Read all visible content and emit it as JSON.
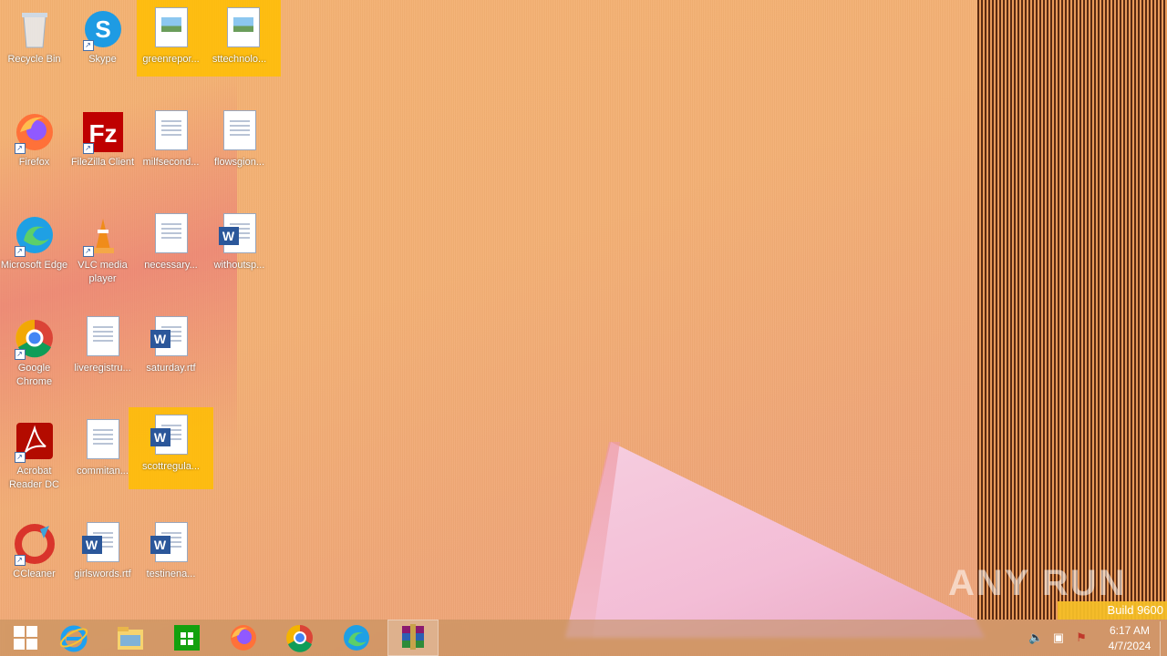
{
  "desktop": {
    "icons": [
      {
        "label": "Recycle Bin",
        "icon": "recycle-bin-icon",
        "type": "app"
      },
      {
        "label": "Skype",
        "icon": "skype-icon",
        "type": "app"
      },
      {
        "label": "greenrepor...",
        "icon": "image-file-icon",
        "type": "img"
      },
      {
        "label": "sttechnolo...",
        "icon": "image-file-icon",
        "type": "img"
      },
      {
        "label": "Firefox",
        "icon": "firefox-icon",
        "type": "app"
      },
      {
        "label": "FileZilla Client",
        "icon": "filezilla-icon",
        "type": "app"
      },
      {
        "label": "milfsecond...",
        "icon": "document-icon",
        "type": "doc"
      },
      {
        "label": "flowsgion...",
        "icon": "document-icon",
        "type": "doc"
      },
      {
        "label": "Microsoft Edge",
        "icon": "edge-icon",
        "type": "app"
      },
      {
        "label": "VLC media player",
        "icon": "vlc-icon",
        "type": "app"
      },
      {
        "label": "necessary...",
        "icon": "document-icon",
        "type": "doc"
      },
      {
        "label": "withoutsp...",
        "icon": "word-document-icon",
        "type": "word"
      },
      {
        "label": "Google Chrome",
        "icon": "chrome-icon",
        "type": "app"
      },
      {
        "label": "liveregistru...",
        "icon": "document-icon",
        "type": "doc"
      },
      {
        "label": "saturday.rtf",
        "icon": "word-document-icon",
        "type": "word"
      },
      {
        "label": "Acrobat Reader DC",
        "icon": "acrobat-icon",
        "type": "app"
      },
      {
        "label": "commitan...",
        "icon": "document-icon",
        "type": "doc"
      },
      {
        "label": "scottregula...",
        "icon": "word-document-icon",
        "type": "word"
      },
      {
        "label": "CCleaner",
        "icon": "ccleaner-icon",
        "type": "app"
      },
      {
        "label": "girlswords.rtf",
        "icon": "word-document-icon",
        "type": "word"
      },
      {
        "label": "testinena...",
        "icon": "word-document-icon",
        "type": "word"
      }
    ]
  },
  "taskbar": {
    "items": [
      {
        "name": "start-button",
        "icon": "windows-logo-icon"
      },
      {
        "name": "internet-explorer",
        "icon": "internet-explorer-icon"
      },
      {
        "name": "file-explorer",
        "icon": "folder-icon"
      },
      {
        "name": "store",
        "icon": "store-icon"
      },
      {
        "name": "firefox",
        "icon": "firefox-icon"
      },
      {
        "name": "chrome",
        "icon": "chrome-icon"
      },
      {
        "name": "edge",
        "icon": "edge-icon"
      },
      {
        "name": "winrar",
        "icon": "winrar-icon"
      }
    ],
    "clock_time": "6:17 AM",
    "clock_date": "4/7/2024"
  },
  "overlay": {
    "build": "Build 9600",
    "watermark": "ANY RUN"
  },
  "colors": {
    "selection": "#ffbe00",
    "taskbar": "#be8c5a"
  }
}
